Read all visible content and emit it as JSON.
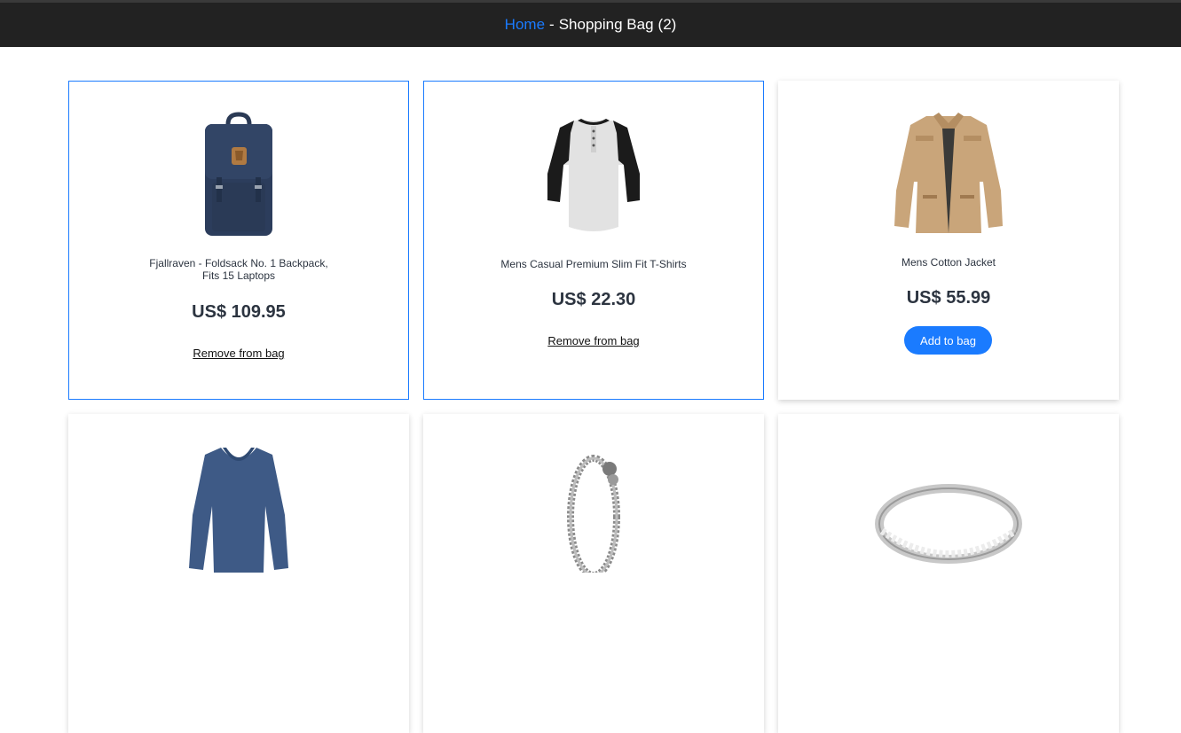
{
  "header": {
    "home_label": "Home",
    "separator": "-",
    "title": "Shopping Bag",
    "count": "(2)"
  },
  "colors": {
    "accent": "#1a7bff",
    "header_bg": "#222222",
    "text": "#2c3440"
  },
  "products": [
    {
      "icon": "backpack-image",
      "title": "Fjallraven - Foldsack No. 1 Backpack, Fits 15 Laptops",
      "price": "US$ 109.95",
      "in_bag": true,
      "action_label": "Remove from bag"
    },
    {
      "icon": "tshirt-image",
      "title": "Mens Casual Premium Slim Fit T-Shirts",
      "price": "US$ 22.30",
      "in_bag": true,
      "action_label": "Remove from bag"
    },
    {
      "icon": "jacket-image",
      "title": "Mens Cotton Jacket",
      "price": "US$ 55.99",
      "in_bag": false,
      "action_label": "Add to bag"
    },
    {
      "icon": "sweater-image",
      "in_bag": false
    },
    {
      "icon": "bracelet-image",
      "in_bag": false
    },
    {
      "icon": "ring-image",
      "in_bag": false
    }
  ]
}
